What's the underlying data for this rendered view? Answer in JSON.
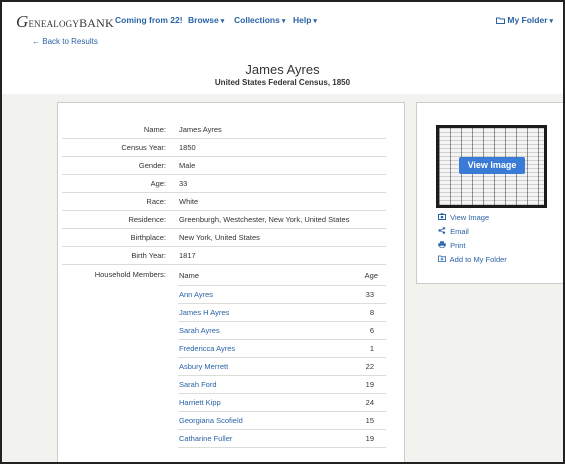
{
  "nav": {
    "logo_initial": "G",
    "logo_rest": "ENEALOGY",
    "logo_bank": "BANK",
    "links": [
      {
        "label": "Coming from 22!",
        "chevron": false
      },
      {
        "label": "Browse",
        "chevron": true
      },
      {
        "label": "Collections",
        "chevron": true
      },
      {
        "label": "Help",
        "chevron": true
      }
    ],
    "my_folder": "My Folder",
    "back": "Back to Results"
  },
  "record": {
    "title": "James Ayres",
    "subtitle": "United States Federal Census, 1850",
    "fields": [
      {
        "label": "Name:",
        "value": "James Ayres"
      },
      {
        "label": "Census Year:",
        "value": "1850"
      },
      {
        "label": "Gender:",
        "value": "Male"
      },
      {
        "label": "Age:",
        "value": "33"
      },
      {
        "label": "Race:",
        "value": "White"
      },
      {
        "label": "Residence:",
        "value": "Greenburgh, Westchester, New York, United States"
      },
      {
        "label": "Birthplace:",
        "value": "New York, United States"
      },
      {
        "label": "Birth Year:",
        "value": "1817"
      }
    ],
    "household_label": "Household Members:",
    "household_headers": {
      "name": "Name",
      "age": "Age"
    },
    "household": [
      {
        "name": "Ann Ayres",
        "age": "33"
      },
      {
        "name": "James H Ayres",
        "age": "8"
      },
      {
        "name": "Sarah Ayres",
        "age": "6"
      },
      {
        "name": "Fredericca Ayres",
        "age": "1"
      },
      {
        "name": "Asbury Merrett",
        "age": "22"
      },
      {
        "name": "Sarah Ford",
        "age": "19"
      },
      {
        "name": "Harriett Kipp",
        "age": "24"
      },
      {
        "name": "Georgiana Scofield",
        "age": "15"
      },
      {
        "name": "Catharine Fuller",
        "age": "19"
      }
    ]
  },
  "sidebar": {
    "view_image_button": "View Image",
    "actions": [
      {
        "label": "View Image",
        "icon": "camera-icon"
      },
      {
        "label": "Email",
        "icon": "share-icon"
      },
      {
        "label": "Print",
        "icon": "printer-icon"
      },
      {
        "label": "Add to My Folder",
        "icon": "folder-add-icon"
      }
    ]
  }
}
